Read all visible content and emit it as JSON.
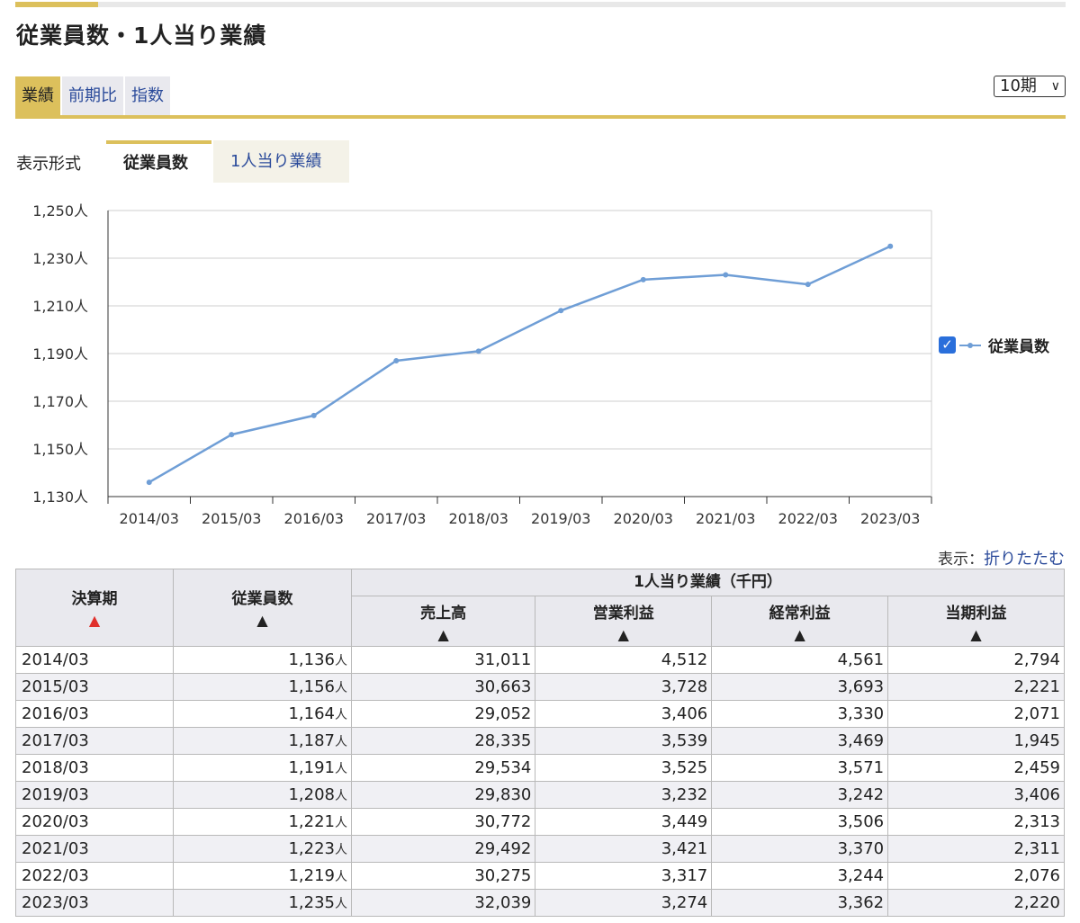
{
  "title": "従業員数・1人当り業績",
  "tabs": [
    "業績",
    "前期比",
    "指数"
  ],
  "period_select": "10期",
  "format": {
    "label": "表示形式",
    "tabs": [
      "従業員数",
      "1人当り業績"
    ]
  },
  "legend": {
    "series_name": "従業員数",
    "checkbox_mark": "✓"
  },
  "display": {
    "label": "表示：",
    "link": "折りたたむ"
  },
  "table": {
    "headers": {
      "period": "決算期",
      "employees": "従業員数",
      "group": "1人当り業績（千円）",
      "sales": "売上高",
      "operating": "営業利益",
      "ordinary": "経常利益",
      "net": "当期利益"
    },
    "sort_mark": "▲",
    "unit": "人",
    "rows": [
      {
        "period": "2014/03",
        "employees": "1,136",
        "sales": "31,011",
        "operating": "4,512",
        "ordinary": "4,561",
        "net": "2,794"
      },
      {
        "period": "2015/03",
        "employees": "1,156",
        "sales": "30,663",
        "operating": "3,728",
        "ordinary": "3,693",
        "net": "2,221"
      },
      {
        "period": "2016/03",
        "employees": "1,164",
        "sales": "29,052",
        "operating": "3,406",
        "ordinary": "3,330",
        "net": "2,071"
      },
      {
        "period": "2017/03",
        "employees": "1,187",
        "sales": "28,335",
        "operating": "3,539",
        "ordinary": "3,469",
        "net": "1,945"
      },
      {
        "period": "2018/03",
        "employees": "1,191",
        "sales": "29,534",
        "operating": "3,525",
        "ordinary": "3,571",
        "net": "2,459"
      },
      {
        "period": "2019/03",
        "employees": "1,208",
        "sales": "29,830",
        "operating": "3,232",
        "ordinary": "3,242",
        "net": "3,406"
      },
      {
        "period": "2020/03",
        "employees": "1,221",
        "sales": "30,772",
        "operating": "3,449",
        "ordinary": "3,506",
        "net": "2,313"
      },
      {
        "period": "2021/03",
        "employees": "1,223",
        "sales": "29,492",
        "operating": "3,421",
        "ordinary": "3,370",
        "net": "2,311"
      },
      {
        "period": "2022/03",
        "employees": "1,219",
        "sales": "30,275",
        "operating": "3,317",
        "ordinary": "3,244",
        "net": "2,076"
      },
      {
        "period": "2023/03",
        "employees": "1,235",
        "sales": "32,039",
        "operating": "3,274",
        "ordinary": "3,362",
        "net": "2,220"
      }
    ]
  },
  "colors": {
    "accent": "#dcc05c",
    "line": "#6f9ed6",
    "link": "#2a4a9a",
    "sort_active": "#e0302c"
  },
  "chart_data": {
    "type": "line",
    "categories": [
      "2014/03",
      "2015/03",
      "2016/03",
      "2017/03",
      "2018/03",
      "2019/03",
      "2020/03",
      "2021/03",
      "2022/03",
      "2023/03"
    ],
    "series": [
      {
        "name": "従業員数",
        "values": [
          1136,
          1156,
          1164,
          1187,
          1191,
          1208,
          1221,
          1223,
          1219,
          1235
        ]
      }
    ],
    "yticks": [
      "1,130人",
      "1,150人",
      "1,170人",
      "1,190人",
      "1,210人",
      "1,230人",
      "1,250人"
    ],
    "ylim": [
      1130,
      1250
    ],
    "grid": true,
    "legend_position": "right"
  }
}
